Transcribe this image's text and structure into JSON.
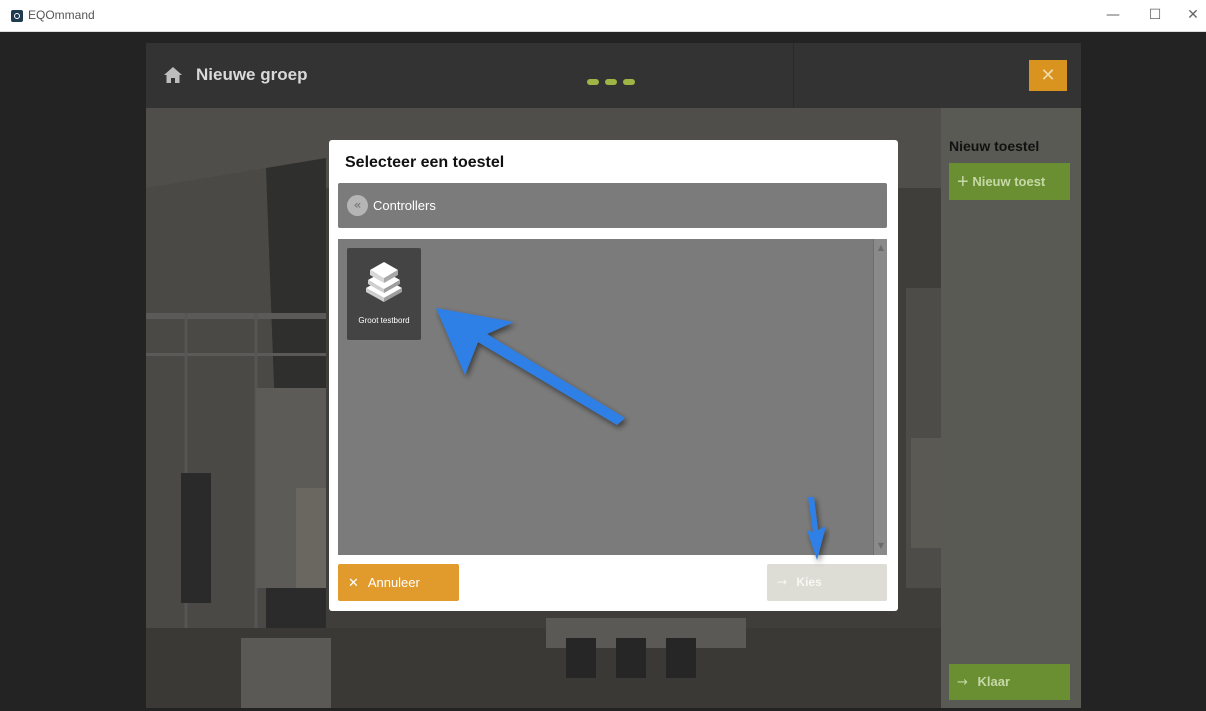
{
  "window": {
    "title": "EQOmmand",
    "minimize_glyph": "—",
    "maximize_glyph": "☐",
    "close_glyph": "✕"
  },
  "header": {
    "title": "Nieuwe groep",
    "home_icon": "home-icon",
    "close_glyph": "✕"
  },
  "right_panel": {
    "title": "Nieuw toestel",
    "new_device_label": "Nieuw toest",
    "done_label": "Klaar"
  },
  "dialog": {
    "title": "Selecteer een toestel",
    "category": "Controllers",
    "back_glyph": "«",
    "devices": [
      {
        "label": "Groot testbord",
        "icon": "device-stack-icon"
      }
    ],
    "cancel_label": "Annuleer",
    "choose_label": "Kies",
    "cancel_glyph": "✕",
    "choose_glyph": "→"
  },
  "colors": {
    "accent_orange": "#e19a2c",
    "accent_green": "#6a8f33",
    "annotation_blue": "#2f7fe6"
  }
}
